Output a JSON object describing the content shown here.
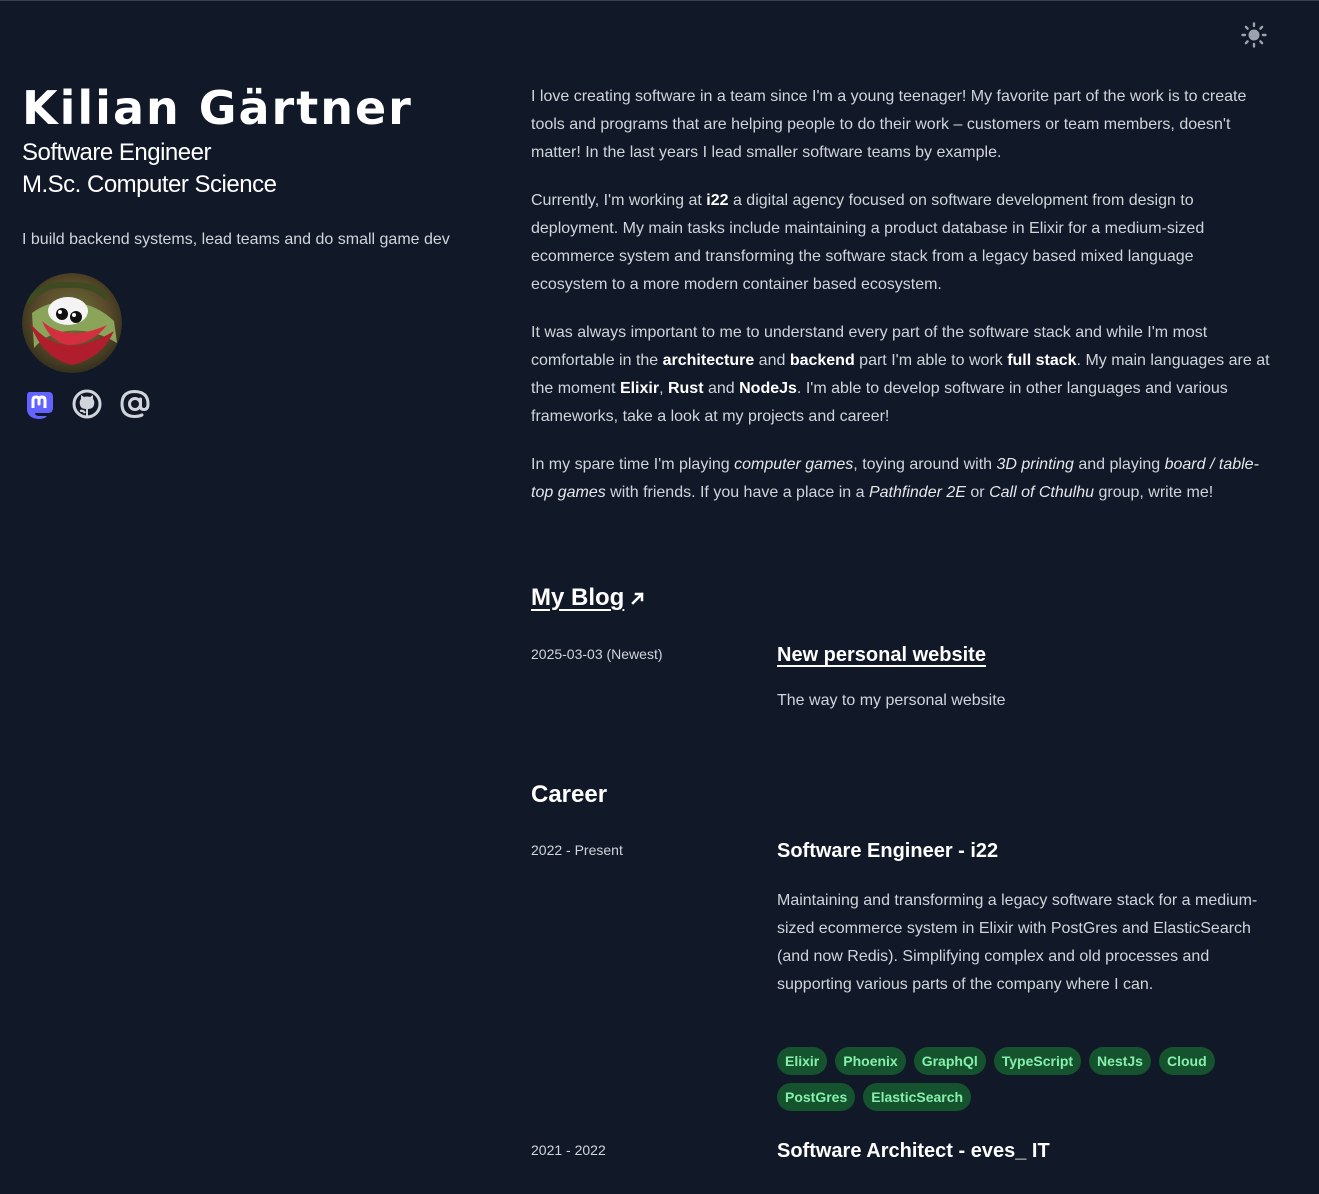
{
  "profile": {
    "name": "Kilian Gärtner",
    "role_line1": "Software Engineer",
    "role_line2": "M.Sc. Computer Science",
    "tagline": "I build backend systems, lead teams and do small game dev"
  },
  "socials": [
    {
      "icon": "mastodon-icon"
    },
    {
      "icon": "github-icon"
    },
    {
      "icon": "at-icon"
    }
  ],
  "about": {
    "p1": "I love creating software in a team since I'm a young teenager! My favorite part of the work is to create tools and programs that are helping people to do their work – customers or team members, doesn't matter! In the last years I lead smaller software teams by example.",
    "p2_a": "Currently, I'm working at ",
    "p2_b": "i22",
    "p2_c": " a digital agency focused on software development from design to deployment. My main tasks include maintaining a product database in Elixir for a medium-sized ecommerce system and transforming the software stack from a legacy based mixed language ecosystem to a more modern container based ecosystem.",
    "p3_a": "It was always important to me to understand every part of the software stack and while I'm most comfortable in the ",
    "p3_b": "architecture",
    "p3_c": " and ",
    "p3_d": "backend",
    "p3_e": " part I'm able to work ",
    "p3_f": "full stack",
    "p3_g": ". My main languages are at the moment ",
    "p3_h": "Elixir",
    "p3_i": ", ",
    "p3_j": "Rust",
    "p3_k": " and ",
    "p3_l": "NodeJs",
    "p3_m": ". I'm able to develop software in other languages and various frameworks, take a look at my projects and career!",
    "p4_a": "In my spare time I'm playing ",
    "p4_b": "computer games",
    "p4_c": ", toying around with ",
    "p4_d": "3D printing",
    "p4_e": " and playing ",
    "p4_f": "board / table-top games",
    "p4_g": " with friends. If you have a place in a ",
    "p4_h": "Pathfinder 2E",
    "p4_i": " or ",
    "p4_j": "Call of Cthulhu",
    "p4_k": " group, write me!"
  },
  "blog": {
    "title": "My Blog",
    "entries": [
      {
        "date": "2025-03-03 (Newest)",
        "title": "New personal website",
        "text": "The way to my personal website"
      }
    ]
  },
  "career": {
    "title": "Career",
    "entries": [
      {
        "date": "2022 - Present",
        "title": "Software Engineer - i22",
        "text": "Maintaining and transforming a legacy software stack for a medium-sized ecommerce system in Elixir with PostGres and ElasticSearch (and now Redis). Simplifying complex and old processes and supporting various parts of the company where I can.",
        "tags": [
          "Elixir",
          "Phoenix",
          "GraphQl",
          "TypeScript",
          "NestJs",
          "Cloud",
          "PostGres",
          "ElasticSearch"
        ]
      },
      {
        "date": "2021 - 2022",
        "title": "Software Architect - eves_ IT"
      }
    ]
  },
  "colors": {
    "background": "#111827",
    "tag_bg": "#14532d",
    "tag_text": "#86efac",
    "mastodon": "#6364ff"
  }
}
